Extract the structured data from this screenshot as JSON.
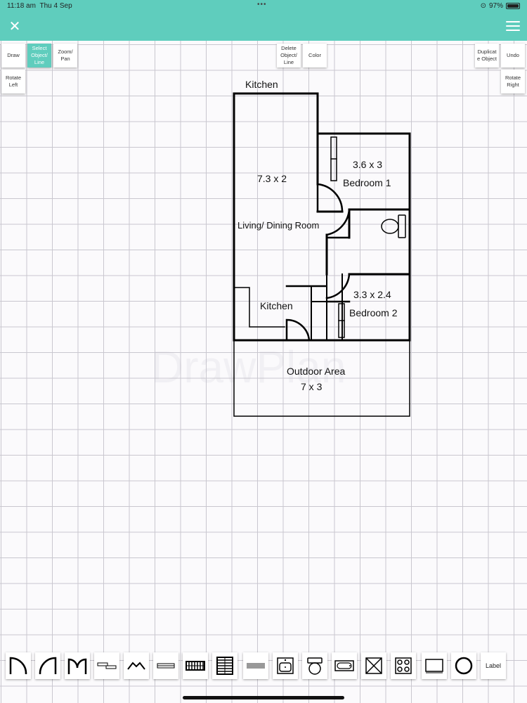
{
  "status": {
    "time": "11:18 am",
    "date": "Thu 4 Sep",
    "battery": "97%",
    "battery_level": 0.97
  },
  "colors": {
    "accent": "#5fcdbd",
    "wall": "#000000"
  },
  "header": {
    "close_icon": "close-icon",
    "menu_icon": "hamburger-menu-icon"
  },
  "toolbar": {
    "draw": "Draw",
    "select": "Select Object/ Line",
    "zoom": "Zoom/ Pan",
    "rotate_left": "Rotate Left",
    "delete": "Delete Object/ Line",
    "color": "Color",
    "duplicate": "Duplicat e Object",
    "undo": "Undo",
    "rotate_right": "Rotate Right"
  },
  "plan": {
    "kitchen_top": "Kitchen",
    "living_size": "7.3 x 2",
    "living_name": "Living/ Dining Room",
    "bedroom1_size": "3.6 x 3",
    "bedroom1_name": "Bedroom 1",
    "bedroom2_size": "3.3 x 2.4",
    "bedroom2_name": "Bedroom 2",
    "kitchen_lower": "Kitchen",
    "outdoor_name": "Outdoor Area",
    "outdoor_size": "7 x 3"
  },
  "watermark": "DrawPlan",
  "palette": {
    "items": [
      "door-icon",
      "door-swing-icon",
      "double-door-icon",
      "sliding-door-icon",
      "bay-window-icon",
      "window-icon",
      "stairs-horizontal-icon",
      "stairs-vertical-icon",
      "wall-block-icon",
      "sink-icon",
      "toilet-icon",
      "bathtub-icon",
      "crossed-box-icon",
      "stove-icon",
      "tv-icon",
      "circle-icon"
    ],
    "label": "Label"
  }
}
